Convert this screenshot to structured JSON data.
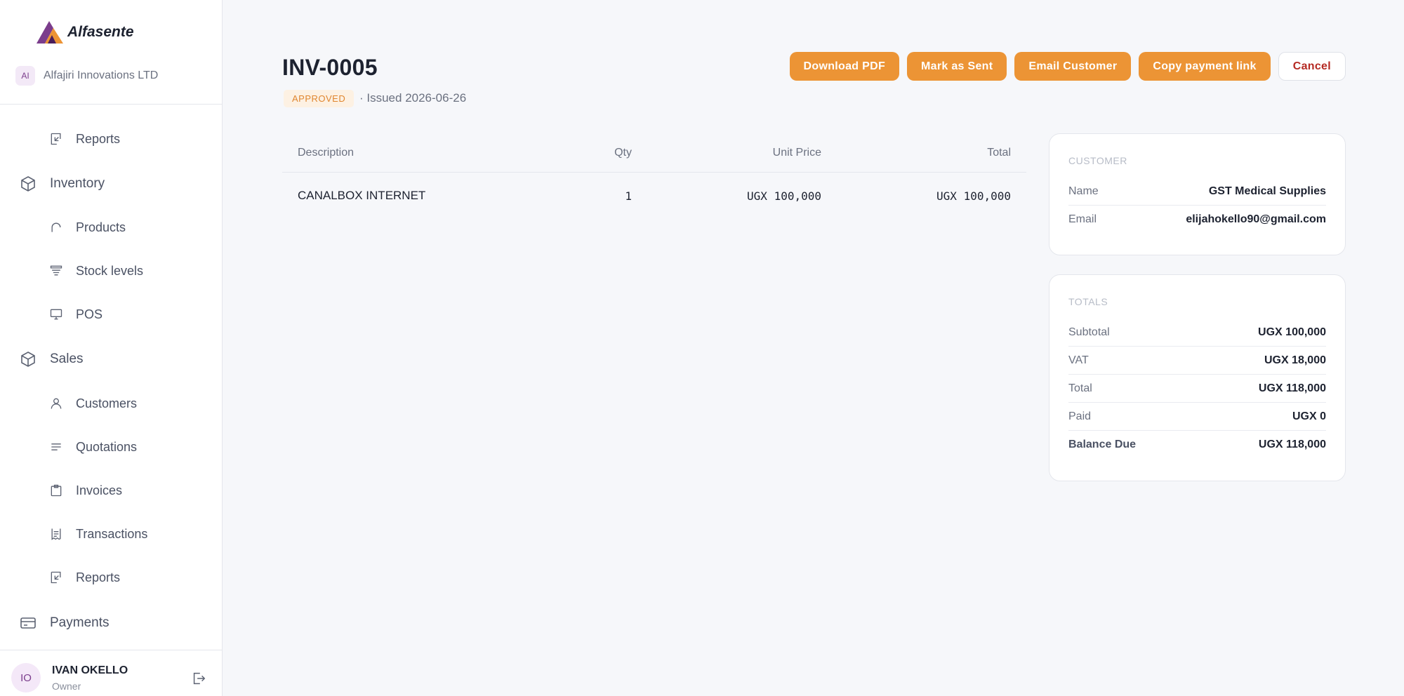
{
  "brand": {
    "name": "Alfasente"
  },
  "org": {
    "badge": "AI",
    "name": "Alfajiri Innovations LTD"
  },
  "nav": {
    "reports_top": "Reports",
    "inventory": "Inventory",
    "products": "Products",
    "stock_levels": "Stock levels",
    "pos": "POS",
    "sales": "Sales",
    "customers": "Customers",
    "quotations": "Quotations",
    "invoices": "Invoices",
    "transactions": "Transactions",
    "reports_sales": "Reports",
    "payments": "Payments"
  },
  "user": {
    "initials": "IO",
    "name": "IVAN OKELLO",
    "role": "Owner"
  },
  "invoice": {
    "number": "INV-0005",
    "status": "APPROVED",
    "issued": "· Issued 2026-06-26"
  },
  "actions": {
    "download_pdf": "Download PDF",
    "mark_sent": "Mark as Sent",
    "email_customer": "Email Customer",
    "copy_link": "Copy payment link",
    "cancel": "Cancel"
  },
  "table": {
    "headers": {
      "description": "Description",
      "qty": "Qty",
      "unit_price": "Unit Price",
      "total": "Total"
    },
    "rows": [
      {
        "description": "CANALBOX INTERNET",
        "qty": "1",
        "unit_price": "UGX 100,000",
        "total": "UGX 100,000"
      }
    ]
  },
  "customer": {
    "title": "CUSTOMER",
    "name_label": "Name",
    "name": "GST Medical Supplies",
    "email_label": "Email",
    "email": "elijahokello90@gmail.com"
  },
  "totals": {
    "title": "TOTALS",
    "subtotal_label": "Subtotal",
    "subtotal": "UGX 100,000",
    "vat_label": "VAT",
    "vat": "UGX 18,000",
    "total_label": "Total",
    "total": "UGX 118,000",
    "paid_label": "Paid",
    "paid": "UGX 0",
    "balance_label": "Balance Due",
    "balance": "UGX 118,000"
  },
  "colors": {
    "accent": "#ec9435",
    "cancel": "#b52a23",
    "status_bg": "#fdf1e3",
    "status_text": "#e0862f"
  }
}
